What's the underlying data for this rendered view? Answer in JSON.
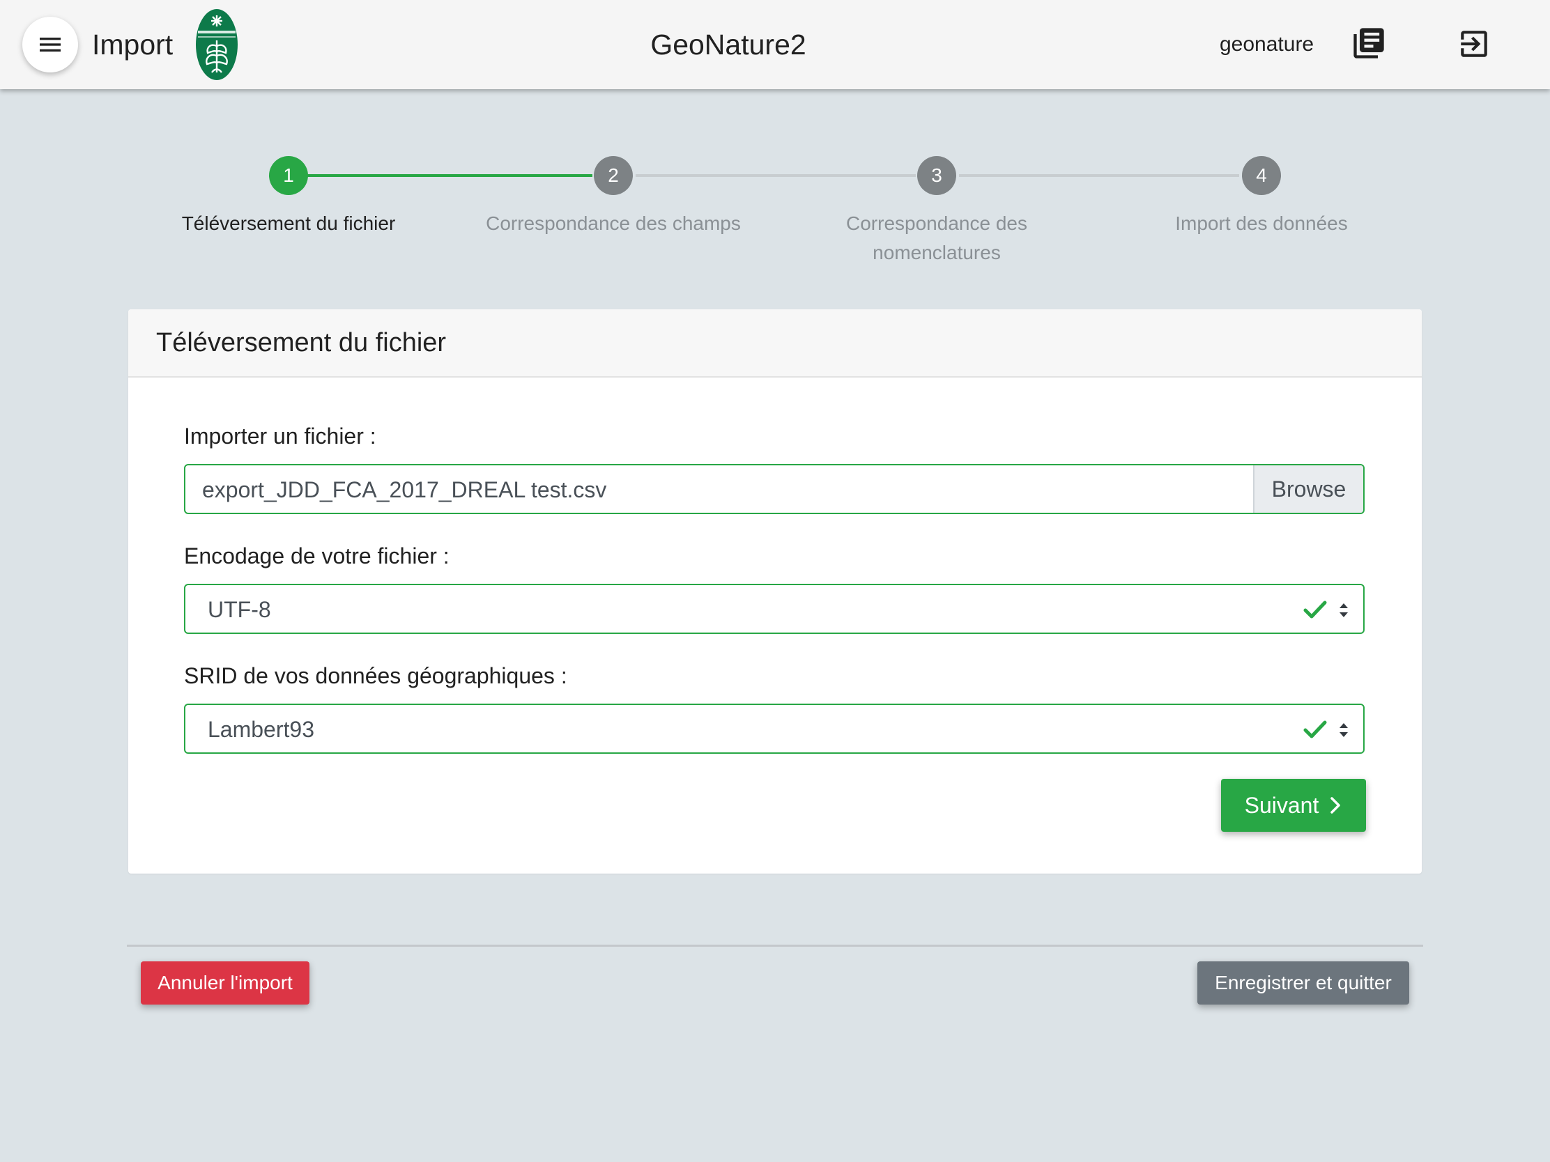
{
  "header": {
    "module_title": "Import",
    "app_title": "GeoNature2",
    "username": "geonature",
    "icons": {
      "menu": "menu-icon",
      "logo": "park-logo",
      "docs": "docs-icon",
      "logout": "logout-icon"
    }
  },
  "stepper": {
    "steps": [
      {
        "number": "1",
        "label": "Téléversement du fichier",
        "state": "active"
      },
      {
        "number": "2",
        "label": "Correspondance des champs",
        "state": "pending"
      },
      {
        "number": "3",
        "label": "Correspondance des nomenclatures",
        "state": "pending"
      },
      {
        "number": "4",
        "label": "Import des données",
        "state": "pending"
      }
    ],
    "colors": {
      "active": "#28a745",
      "pending": "#7d8285",
      "line_inactive": "#c8cdd0"
    }
  },
  "card": {
    "title": "Téléversement du fichier",
    "file": {
      "label": "Importer un fichier :",
      "value": "export_JDD_FCA_2017_DREAL test.csv",
      "browse_label": "Browse"
    },
    "encoding": {
      "label": "Encodage de votre fichier :",
      "value": "UTF-8"
    },
    "srid": {
      "label": "SRID de vos données géographiques :",
      "value": "Lambert93"
    },
    "next_label": "Suivant"
  },
  "footer": {
    "cancel_label": "Annuler l'import",
    "save_label": "Enregistrer et quitter"
  },
  "colors": {
    "success": "#28a745",
    "danger": "#dc3545",
    "secondary": "#6c757d",
    "background": "#dce3e7"
  }
}
